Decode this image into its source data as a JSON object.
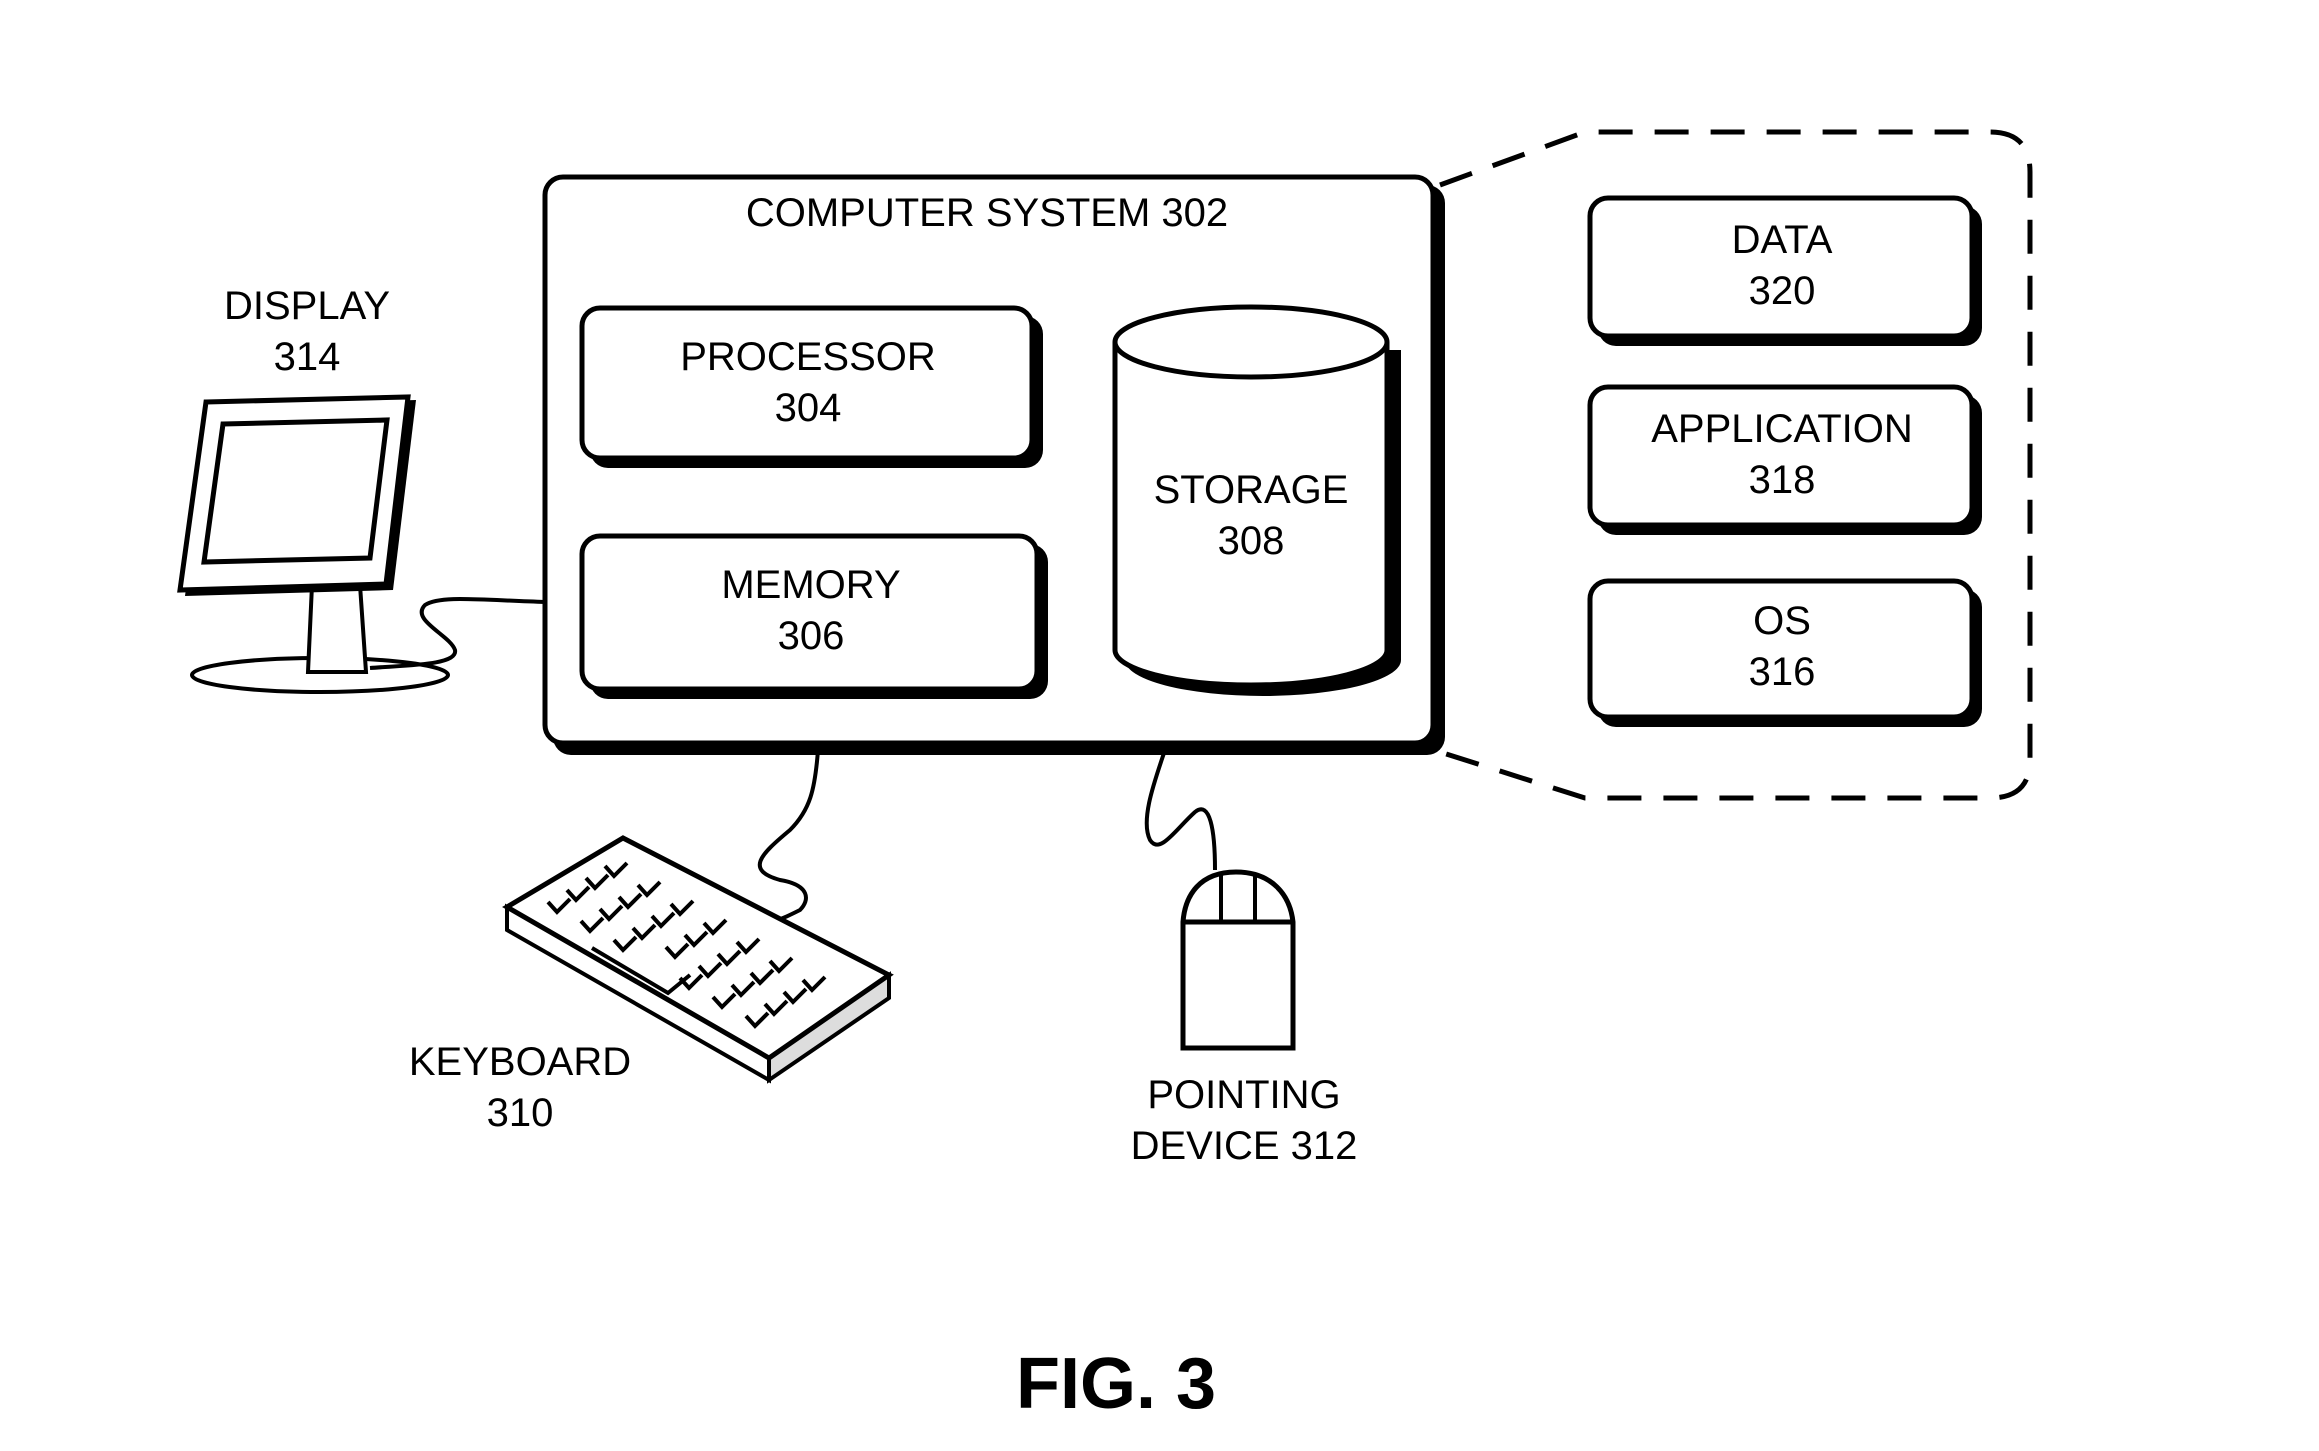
{
  "figure": {
    "caption": "FIG. 3"
  },
  "computer_system": {
    "label": "COMPUTER SYSTEM 302",
    "processor": {
      "name": "PROCESSOR",
      "ref": "304"
    },
    "memory": {
      "name": "MEMORY",
      "ref": "306"
    },
    "storage": {
      "name": "STORAGE",
      "ref": "308"
    }
  },
  "storage_contents": [
    {
      "name": "DATA",
      "ref": "320"
    },
    {
      "name": "APPLICATION",
      "ref": "318"
    },
    {
      "name": "OS",
      "ref": "316"
    }
  ],
  "peripherals": {
    "display": {
      "name": "DISPLAY",
      "ref": "314"
    },
    "keyboard": {
      "name": "KEYBOARD",
      "ref": "310"
    },
    "pointing_device": {
      "line1": "POINTING",
      "line2": "DEVICE 312"
    }
  }
}
